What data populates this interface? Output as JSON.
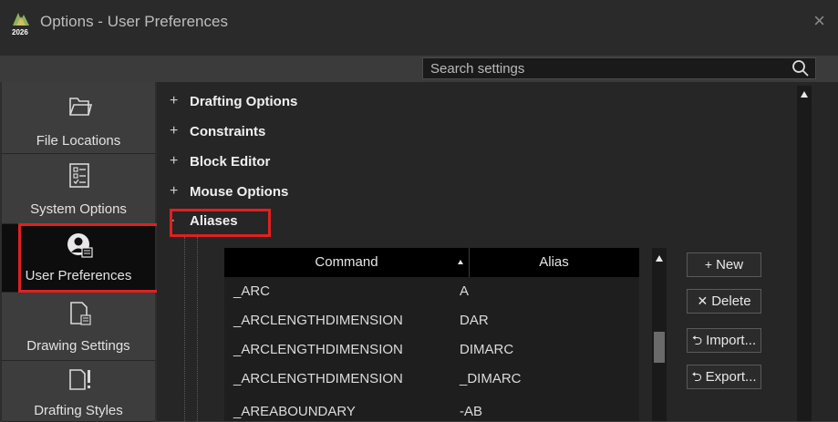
{
  "window": {
    "title": "Options - User Preferences",
    "logo_year": "2026",
    "close_glyph": "×"
  },
  "search": {
    "placeholder": "Search settings",
    "icon": "search-icon"
  },
  "nav": {
    "items": [
      {
        "label": "File Locations",
        "icon": "folder-icon"
      },
      {
        "label": "System Options",
        "icon": "checklist-icon"
      },
      {
        "label": "User Preferences",
        "icon": "user-preferences-icon",
        "active": true
      },
      {
        "label": "Drawing Settings",
        "icon": "drawing-settings-icon"
      },
      {
        "label": "Drafting Styles",
        "icon": "drafting-styles-icon"
      }
    ]
  },
  "categories": [
    {
      "prefix": "+",
      "label": "Drafting Options"
    },
    {
      "prefix": "+",
      "label": "Constraints"
    },
    {
      "prefix": "+",
      "label": "Block Editor"
    },
    {
      "prefix": "+",
      "label": "Mouse Options"
    },
    {
      "prefix": "-",
      "label": "Aliases",
      "expanded": true
    }
  ],
  "aliases_table": {
    "columns": [
      "Command",
      "Alias"
    ],
    "sort_column": "Command",
    "rows": [
      {
        "command": "_ARC",
        "alias": "A"
      },
      {
        "command": "_ARCLENGTHDIMENSION",
        "alias": "DAR"
      },
      {
        "command": "_ARCLENGTHDIMENSION",
        "alias": "DIMARC"
      },
      {
        "command": "_ARCLENGTHDIMENSION",
        "alias": "_DIMARC"
      },
      {
        "command": "_AREABOUNDARY",
        "alias": "-AB"
      }
    ]
  },
  "buttons": {
    "new": {
      "glyph": "+",
      "label": "New"
    },
    "delete": {
      "glyph": "✕",
      "label": "Delete"
    },
    "import": {
      "glyph": "⮌",
      "label": "Import..."
    },
    "export": {
      "glyph": "⮌",
      "label": "Export..."
    }
  },
  "colors": {
    "highlight": "#e02020",
    "background": "#262626",
    "header": "#000000"
  }
}
